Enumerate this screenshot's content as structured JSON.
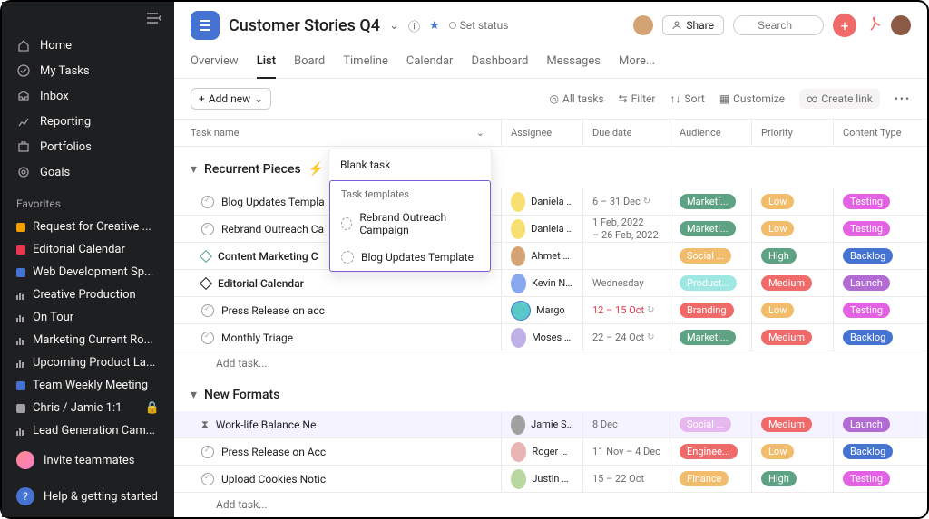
{
  "sidebar": {
    "items": [
      {
        "label": "Home"
      },
      {
        "label": "My Tasks"
      },
      {
        "label": "Inbox"
      },
      {
        "label": "Reporting"
      },
      {
        "label": "Portfolios"
      },
      {
        "label": "Goals"
      }
    ],
    "favorites_header": "Favorites",
    "favorites": [
      {
        "label": "Request for Creative ...",
        "type": "dot",
        "color": "#f2a100"
      },
      {
        "label": "Editorial Calendar",
        "type": "dot",
        "color": "#e8384f"
      },
      {
        "label": "Web Development Sp...",
        "type": "dot",
        "color": "#4573d2"
      },
      {
        "label": "Creative Production",
        "type": "bars"
      },
      {
        "label": "On Tour",
        "type": "bars"
      },
      {
        "label": "Marketing Current Ro...",
        "type": "bars"
      },
      {
        "label": "Upcoming Product La...",
        "type": "bars"
      },
      {
        "label": "Team Weekly Meeting",
        "type": "dot",
        "color": "#4573d2"
      },
      {
        "label": "Chris / Jamie 1:1",
        "type": "dot",
        "color": "#a2a0a2",
        "locked": true
      },
      {
        "label": "Lead Generation Cam...",
        "type": "bars"
      }
    ],
    "invite_label": "Invite teammates",
    "help_label": "Help & getting started"
  },
  "header": {
    "title": "Customer Stories Q4",
    "set_status_label": "Set status",
    "share_label": "Share",
    "search_placeholder": "Search"
  },
  "tabs": [
    "Overview",
    "List",
    "Board",
    "Timeline",
    "Calendar",
    "Dashboard",
    "Messages",
    "More..."
  ],
  "active_tab": "List",
  "toolbar": {
    "add_new": "Add new",
    "all_tasks": "All tasks",
    "filter": "Filter",
    "sort": "Sort",
    "customize": "Customize",
    "create_link": "Create link"
  },
  "columns": {
    "task": "Task name",
    "assignee": "Assignee",
    "due": "Due date",
    "audience": "Audience",
    "priority": "Priority",
    "content_type": "Content Type"
  },
  "popup": {
    "blank": "Blank task",
    "templates_label": "Task templates",
    "templates": [
      "Rebrand Outreach Campaign",
      "Blog Updates Template"
    ]
  },
  "sections": [
    {
      "name": "Recurrent Pieces",
      "bolt": true,
      "tasks": [
        {
          "icon": "check",
          "name": "Blog Updates Templa",
          "assignee": "Daniela Var...",
          "av": "av1",
          "due": "6 – 31 Dec",
          "recur": true,
          "aud": {
            "t": "Marketi...",
            "c": "#5da283"
          },
          "pri": {
            "t": "Low",
            "c": "#f1bd6c"
          },
          "ct": {
            "t": "Testing",
            "c": "#e362e3"
          }
        },
        {
          "icon": "check",
          "name": "Rebrand Outreach Ca",
          "assignee": "Daniela Var...",
          "av": "av1",
          "due_stack": [
            "1 Feb, 2022",
            "– 26 Feb, 2022"
          ],
          "aud": {
            "t": "Marketi...",
            "c": "#5da283"
          },
          "pri": {
            "t": "Low",
            "c": "#f1bd6c"
          },
          "ct": {
            "t": "Testing",
            "c": "#e362e3"
          }
        },
        {
          "icon": "milestone-green",
          "name": "Content Marketing C",
          "bold": true,
          "assignee": "Ahmet Aslan",
          "av": "av2",
          "due": "",
          "aud": {
            "t": "Social ...",
            "c": "#f1bd6c"
          },
          "pri": {
            "t": "High",
            "c": "#5da283"
          },
          "ct": {
            "t": "Backlog",
            "c": "#4573d2"
          }
        },
        {
          "icon": "milestone",
          "name": "Editorial Calendar",
          "bold": true,
          "assignee": "Kevin New...",
          "av": "av3",
          "due": "Wednesday",
          "aud": {
            "t": "Product...",
            "c": "#9ee7e3"
          },
          "pri": {
            "t": "Medium",
            "c": "#f06a6a"
          },
          "ct": {
            "t": "Launch",
            "c": "#b36bd4"
          }
        },
        {
          "icon": "check",
          "name": "Press Release on acc",
          "assignee": "Margo",
          "av": "av4",
          "due": "12 – 15 Oct",
          "due_red": true,
          "recur": true,
          "aud": {
            "t": "Branding",
            "c": "#f06a6a"
          },
          "pri": {
            "t": "Low",
            "c": "#f1bd6c"
          },
          "ct": {
            "t": "Testing",
            "c": "#e362e3"
          }
        },
        {
          "icon": "check",
          "name": "Monthly Triage",
          "assignee": "Moses Fidel",
          "av": "av5",
          "due": "22 – 24 Oct",
          "recur": true,
          "aud": {
            "t": "Marketi...",
            "c": "#5da283"
          },
          "pri": {
            "t": "Medium",
            "c": "#f06a6a"
          },
          "ct": {
            "t": "Backlog",
            "c": "#4573d2"
          }
        }
      ],
      "add_task": "Add task..."
    },
    {
      "name": "New Formats",
      "tasks": [
        {
          "icon": "hourglass",
          "name": "Work-life Balance Ne",
          "assignee": "Jamie Stap...",
          "av": "av6",
          "due": "8 Dec",
          "aud": {
            "t": "Social ...",
            "c": "#e7b8f0"
          },
          "pri": {
            "t": "Medium",
            "c": "#f06a6a"
          },
          "ct": {
            "t": "Launch",
            "c": "#b36bd4"
          },
          "highlight": true
        },
        {
          "icon": "check",
          "name": "Press Release on Acc",
          "assignee": "Roger Ray...",
          "av": "av7",
          "due": "11 Nov – 4 Dec",
          "aud": {
            "t": "Enginee...",
            "c": "#f06a6a"
          },
          "pri": {
            "t": "Low",
            "c": "#f1bd6c"
          },
          "ct": {
            "t": "Backlog",
            "c": "#4573d2"
          }
        },
        {
          "icon": "check",
          "name": "Upload Cookies Notic",
          "assignee": "Justin Dean",
          "av": "av8",
          "due": "15 – 22 Oct",
          "aud": {
            "t": "Finance",
            "c": "#f1bd6c"
          },
          "pri": {
            "t": "High",
            "c": "#5da283"
          },
          "ct": {
            "t": "Testing",
            "c": "#e362e3"
          }
        }
      ],
      "add_task": "Add task..."
    }
  ]
}
